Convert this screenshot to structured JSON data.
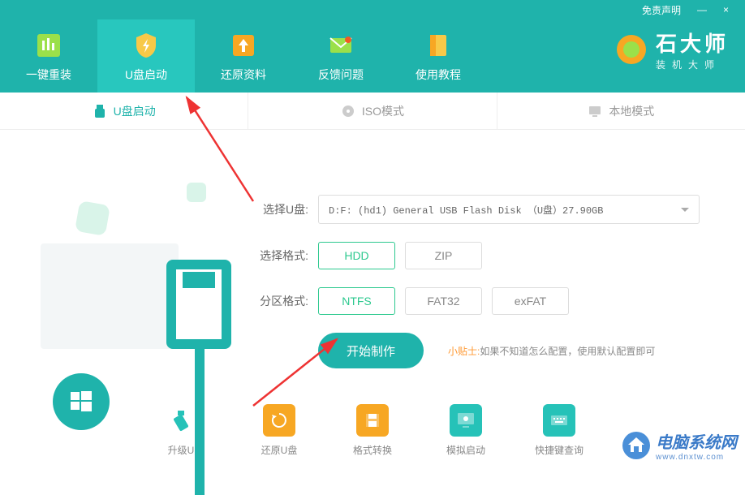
{
  "topbar": {
    "disclaimer": "免责声明",
    "minimize": "—",
    "close": "×"
  },
  "nav": {
    "items": [
      {
        "label": "一键重装",
        "icon": "reinstall"
      },
      {
        "label": "U盘启动",
        "icon": "usb-boot"
      },
      {
        "label": "还原资料",
        "icon": "restore"
      },
      {
        "label": "反馈问题",
        "icon": "feedback"
      },
      {
        "label": "使用教程",
        "icon": "tutorial"
      }
    ],
    "logo_title": "石大师",
    "logo_sub": "装机大师"
  },
  "subtabs": {
    "items": [
      {
        "label": "U盘启动",
        "icon": "usb"
      },
      {
        "label": "ISO模式",
        "icon": "iso"
      },
      {
        "label": "本地模式",
        "icon": "local"
      }
    ]
  },
  "form": {
    "select_usb_label": "选择U盘:",
    "select_usb_value": "D:F: (hd1) General USB Flash Disk （U盘）27.90GB",
    "select_format_label": "选择格式:",
    "format_options": [
      "HDD",
      "ZIP"
    ],
    "partition_format_label": "分区格式:",
    "partition_options": [
      "NTFS",
      "FAT32",
      "exFAT"
    ],
    "start_button": "开始制作",
    "tip_label": "小贴士:",
    "tip_text": "如果不知道怎么配置，使用默认配置即可"
  },
  "tools": {
    "items": [
      {
        "label": "升级U盘"
      },
      {
        "label": "还原U盘"
      },
      {
        "label": "格式转换"
      },
      {
        "label": "模拟启动"
      },
      {
        "label": "快捷键查询"
      }
    ]
  },
  "watermark": {
    "title": "电脑系统网",
    "sub": "www.dnxtw.com"
  }
}
